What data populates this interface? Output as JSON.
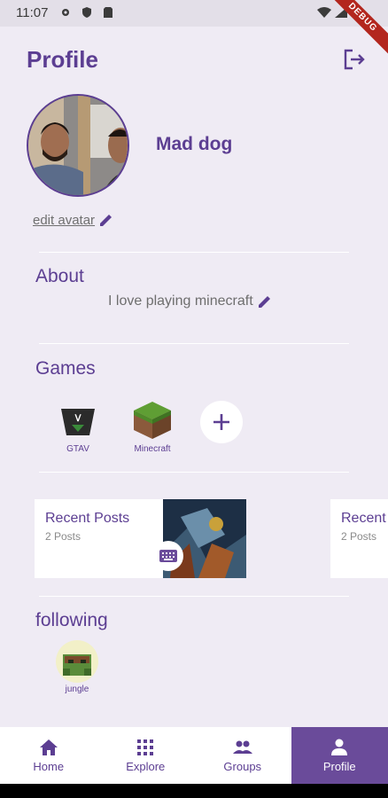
{
  "status_bar": {
    "time": "11:07",
    "debug": "DEBUG"
  },
  "header": {
    "title": "Profile"
  },
  "profile": {
    "username": "Mad dog",
    "edit_avatar_label": "edit avatar"
  },
  "about": {
    "title": "About",
    "text": "I love playing minecraft"
  },
  "games": {
    "title": "Games",
    "items": [
      {
        "label": "GTAV"
      },
      {
        "label": "Minecraft"
      }
    ]
  },
  "posts": {
    "cards": [
      {
        "title": "Recent Posts",
        "count": "2 Posts"
      },
      {
        "title": "Recent Posts",
        "count": "2 Posts"
      }
    ]
  },
  "following": {
    "title": "following",
    "items": [
      {
        "label": "jungle"
      }
    ]
  },
  "nav": {
    "items": [
      {
        "label": "Home",
        "icon": "home-icon"
      },
      {
        "label": "Explore",
        "icon": "grid-icon"
      },
      {
        "label": "Groups",
        "icon": "people-icon"
      },
      {
        "label": "Profile",
        "icon": "person-icon"
      }
    ],
    "active_index": 3
  },
  "colors": {
    "primary": "#5c3e92",
    "nav_active": "#6a4b9a",
    "background": "#efebf4"
  }
}
